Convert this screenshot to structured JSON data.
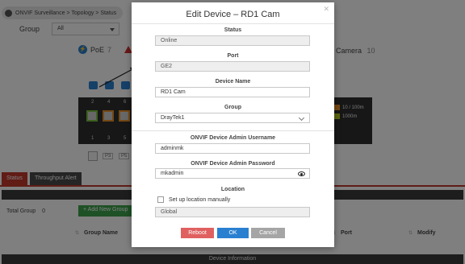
{
  "background": {
    "breadcrumb": "ONVIF Surveillance > Topology > Status",
    "group_label": "Group",
    "group_value": "All",
    "poe_label": "PoE",
    "poe_count": "7",
    "camera_label": "Camera",
    "camera_count": "10",
    "ports": {
      "top_numbers": [
        "2",
        "4",
        "6"
      ],
      "bottom_numbers": [
        "1",
        "3",
        "5"
      ],
      "p_tags": [
        "P3",
        "P5"
      ]
    },
    "legend": [
      "10 / 100m",
      "1000m"
    ],
    "tabs": [
      "Status",
      "Throughput Alert"
    ],
    "total_group_label": "Total Group",
    "total_group_count": "0",
    "add_group_button": "+ Add New Group",
    "columns": [
      "Group Name",
      "Port",
      "Modify"
    ],
    "footer": "Device Information"
  },
  "modal": {
    "title": "Edit Device – RD1 Cam",
    "status_label": "Status",
    "status_value": "Online",
    "port_label": "Port",
    "port_value": "GE2",
    "device_name_label": "Device Name",
    "device_name_value": "RD1 Cam",
    "group_label": "Group",
    "group_value": "DrayTek1",
    "username_label": "ONVIF Device Admin Username",
    "username_value": "adminmk",
    "password_label": "ONVIF Device Admin Password",
    "password_value": "mkadmin",
    "location_label": "Location",
    "location_checkbox_label": "Set up location manually",
    "location_value": "Global",
    "buttons": {
      "reboot": "Reboot",
      "ok": "OK",
      "cancel": "Cancel"
    }
  },
  "colors": {
    "accent_blue": "#2a80d0",
    "reboot_red": "#e06060",
    "cancel_gray": "#a5a5a5",
    "tab_red": "#c0392b",
    "add_green": "#3fa34d"
  }
}
